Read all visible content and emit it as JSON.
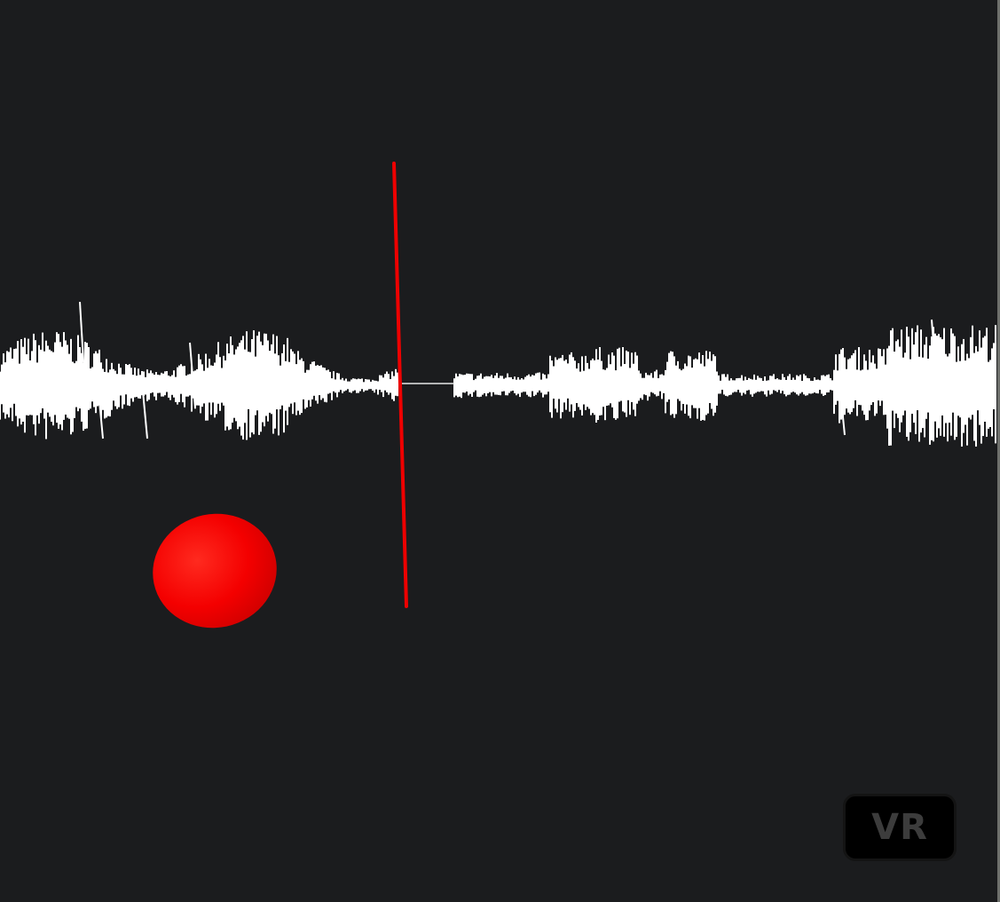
{
  "vr_button": {
    "label": "VR"
  },
  "colors": {
    "background": "#1b1c1e",
    "waveform": "#ffffff",
    "playhead": "#ee0000",
    "sphere": "#ff0000",
    "vr_button_bg": "#000000",
    "vr_button_text": "#3c3c3c"
  },
  "icons": {
    "playhead": "playhead-line",
    "sphere": "red-sphere"
  }
}
